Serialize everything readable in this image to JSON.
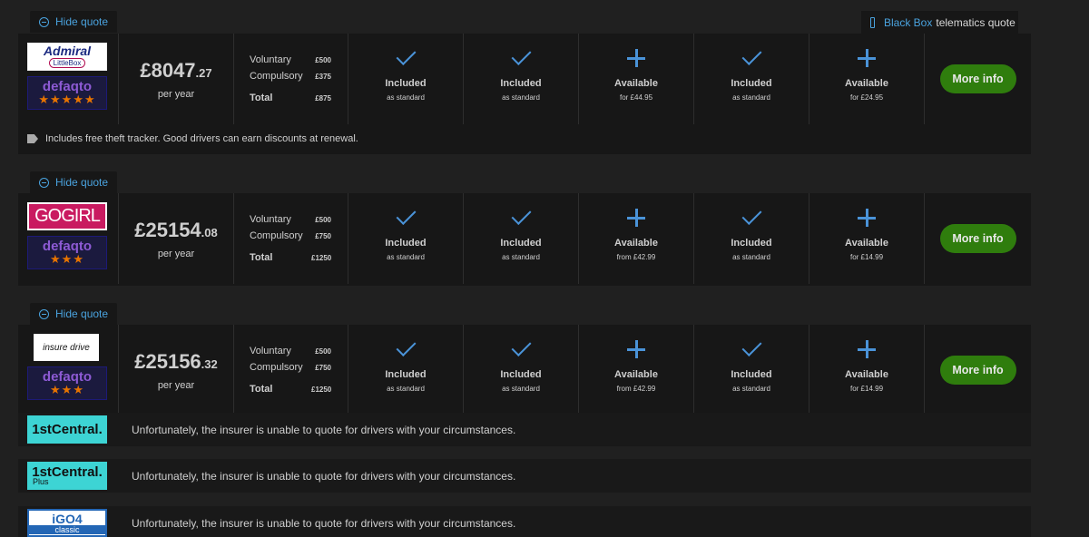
{
  "hide_quote_label": "Hide quote",
  "black_box": {
    "label_blue": "Black Box",
    "label_rest": "telematics quote"
  },
  "more_info_label": "More info",
  "quotes": [
    {
      "insurer_logo_text": [
        "Admiral",
        "LittleBox"
      ],
      "defaqto": {
        "name": "defaqto",
        "stars": "★★★★★"
      },
      "price": {
        "pounds": "£8047",
        "pence": ".27",
        "period": "per year"
      },
      "excess": {
        "voluntary_label": "Voluntary",
        "voluntary": "£500",
        "compulsory_label": "Compulsory",
        "compulsory": "£375",
        "total_label": "Total",
        "total": "£875"
      },
      "features": [
        {
          "status": "Included",
          "sub": "as standard",
          "icon": "check-icon"
        },
        {
          "status": "Included",
          "sub": "as standard",
          "icon": "check-icon"
        },
        {
          "status": "Available",
          "sub": "for £44.95",
          "icon": "plus-icon"
        },
        {
          "status": "Included",
          "sub": "as standard",
          "icon": "check-icon"
        },
        {
          "status": "Available",
          "sub": "for £24.95",
          "icon": "plus-icon"
        }
      ],
      "note": "Includes free theft tracker. Good drivers can earn discounts at renewal."
    },
    {
      "insurer_logo_text": [
        "GOGIRL"
      ],
      "defaqto": {
        "name": "defaqto",
        "stars": "★★★"
      },
      "price": {
        "pounds": "£25154",
        "pence": ".08",
        "period": "per year"
      },
      "excess": {
        "voluntary_label": "Voluntary",
        "voluntary": "£500",
        "compulsory_label": "Compulsory",
        "compulsory": "£750",
        "total_label": "Total",
        "total": "£1250"
      },
      "features": [
        {
          "status": "Included",
          "sub": "as standard",
          "icon": "check-icon"
        },
        {
          "status": "Included",
          "sub": "as standard",
          "icon": "check-icon"
        },
        {
          "status": "Available",
          "sub": "from £42.99",
          "icon": "plus-icon"
        },
        {
          "status": "Included",
          "sub": "as standard",
          "icon": "check-icon"
        },
        {
          "status": "Available",
          "sub": "for £14.99",
          "icon": "plus-icon"
        }
      ]
    },
    {
      "insurer_logo_text": [
        "insure",
        "drive"
      ],
      "defaqto": {
        "name": "defaqto",
        "stars": "★★★"
      },
      "price": {
        "pounds": "£25156",
        "pence": ".32",
        "period": "per year"
      },
      "excess": {
        "voluntary_label": "Voluntary",
        "voluntary": "£500",
        "compulsory_label": "Compulsory",
        "compulsory": "£750",
        "total_label": "Total",
        "total": "£1250"
      },
      "features": [
        {
          "status": "Included",
          "sub": "as standard",
          "icon": "check-icon"
        },
        {
          "status": "Included",
          "sub": "as standard",
          "icon": "check-icon"
        },
        {
          "status": "Available",
          "sub": "from £42.99",
          "icon": "plus-icon"
        },
        {
          "status": "Included",
          "sub": "as standard",
          "icon": "check-icon"
        },
        {
          "status": "Available",
          "sub": "for £14.99",
          "icon": "plus-icon"
        }
      ]
    }
  ],
  "declined": [
    {
      "logo_text": [
        "1stCentral."
      ],
      "message": "Unfortunately, the insurer is unable to quote for drivers with your circumstances."
    },
    {
      "logo_text": [
        "1stCentral.",
        "Plus"
      ],
      "message": "Unfortunately, the insurer is unable to quote for drivers with your circumstances."
    },
    {
      "logo_text": [
        "iGO4",
        "classic"
      ],
      "message": "Unfortunately, the insurer is unable to quote for drivers with your circumstances."
    }
  ],
  "colors": {
    "accent_blue": "#4aa3df",
    "button_green": "#2f7d0d",
    "stars_orange": "#e67300",
    "panel": "#171717",
    "background": "#202020"
  }
}
